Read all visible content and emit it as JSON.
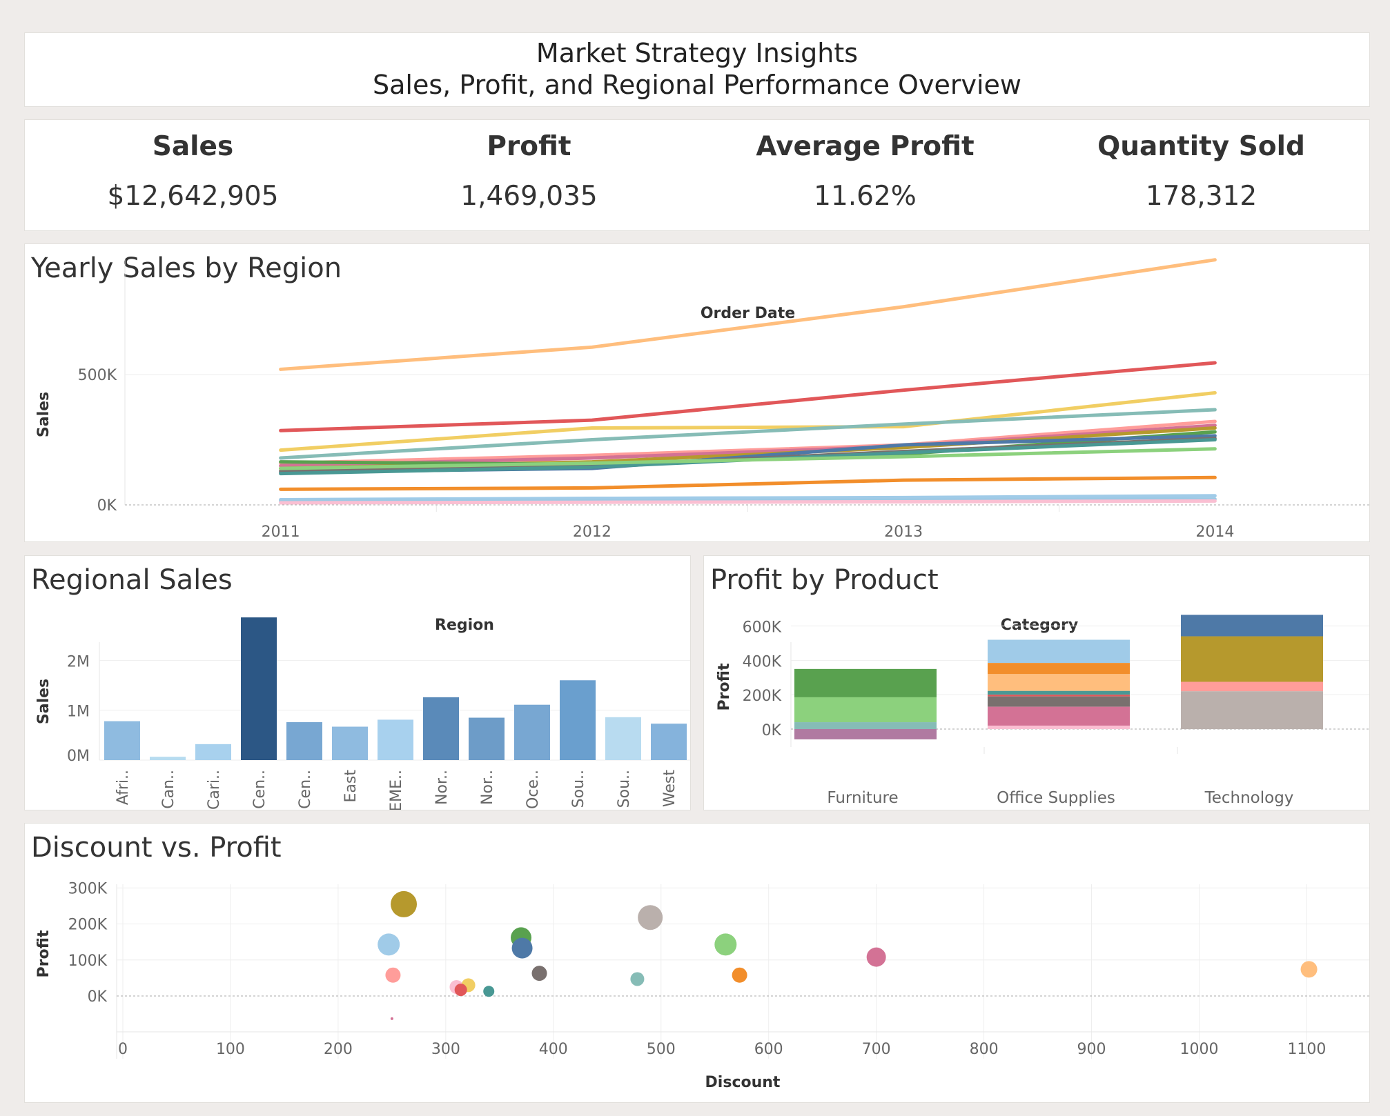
{
  "header": {
    "title_line1": "Market Strategy Insights",
    "title_line2": "Sales, Profit, and Regional Performance Overview"
  },
  "kpis": [
    {
      "label": "Sales",
      "value": "$12,642,905"
    },
    {
      "label": "Profit",
      "value": "1,469,035"
    },
    {
      "label": "Average Profit",
      "value": "11.62%"
    },
    {
      "label": "Quantity Sold",
      "value": "178,312"
    }
  ],
  "panels": {
    "line_title": "Yearly Sales by Region",
    "bar_title": "Regional Sales",
    "stack_title": "Profit by Product",
    "scatter_title": "Discount vs. Profit"
  },
  "chart_data": [
    {
      "type": "line",
      "title": "Yearly Sales by Region",
      "xlabel": "Order Date",
      "ylabel": "Sales",
      "x": [
        "2011",
        "2012",
        "2013",
        "2014"
      ],
      "ylim": [
        0,
        1000000
      ],
      "yticks": [
        {
          "v": 500000,
          "label": "500K"
        },
        {
          "v": 0,
          "label": "0K"
        }
      ],
      "series": [
        {
          "color": "#ffbe7d",
          "values": [
            520000,
            605000,
            760000,
            940000
          ]
        },
        {
          "color": "#e15759",
          "values": [
            285000,
            325000,
            440000,
            545000
          ]
        },
        {
          "color": "#f1ce63",
          "values": [
            210000,
            295000,
            300000,
            430000
          ]
        },
        {
          "color": "#86bcb6",
          "values": [
            180000,
            250000,
            310000,
            365000
          ]
        },
        {
          "color": "#ff9d9a",
          "values": [
            160000,
            190000,
            230000,
            320000
          ]
        },
        {
          "color": "#d37295",
          "values": [
            150000,
            180000,
            225000,
            305000
          ]
        },
        {
          "color": "#b6992d",
          "values": [
            140000,
            165000,
            220000,
            295000
          ]
        },
        {
          "color": "#59a14f",
          "values": [
            165000,
            155000,
            195000,
            280000
          ]
        },
        {
          "color": "#4e79a7",
          "values": [
            125000,
            140000,
            230000,
            265000
          ]
        },
        {
          "color": "#79706e",
          "values": [
            130000,
            150000,
            205000,
            255000
          ]
        },
        {
          "color": "#499894",
          "values": [
            120000,
            145000,
            200000,
            250000
          ]
        },
        {
          "color": "#8cd17d",
          "values": [
            140000,
            160000,
            185000,
            215000
          ]
        },
        {
          "color": "#f28e2b",
          "values": [
            60000,
            65000,
            95000,
            105000
          ]
        },
        {
          "color": "#a0cbe8",
          "values": [
            20000,
            25000,
            28000,
            35000
          ]
        },
        {
          "color": "#9dc9e4",
          "values": [
            15000,
            15000,
            18000,
            22000
          ]
        },
        {
          "color": "#fabfd2",
          "values": [
            8000,
            10000,
            12000,
            15000
          ]
        }
      ]
    },
    {
      "type": "bar",
      "title": "Regional Sales",
      "xlabel": "Region",
      "ylabel": "Sales",
      "categories": [
        "Afri..",
        "Can..",
        "Cari..",
        "Cen..",
        "Cen..",
        "East",
        "EME..",
        "Nor..",
        "Nor..",
        "Oce..",
        "Sou..",
        "Sou..",
        "West"
      ],
      "values": [
        780000,
        67000,
        320000,
        2860000,
        760000,
        670000,
        810000,
        1260000,
        850000,
        1110000,
        1600000,
        860000,
        730000
      ],
      "colors": [
        "#8fbbe0",
        "#b7dcf0",
        "#a8d1ee",
        "#2c5785",
        "#78a7d2",
        "#8fbbe0",
        "#a8d1ee",
        "#5a8ab9",
        "#6d9cc8",
        "#78a7d2",
        "#6a9fce",
        "#b8dbf0",
        "#85b3dc"
      ],
      "ylim": [
        0,
        3000000
      ],
      "yticks": [
        {
          "v": 2000000,
          "label": "2M"
        },
        {
          "v": 1000000,
          "label": "1M"
        },
        {
          "v": 0,
          "label": "0M"
        }
      ]
    },
    {
      "type": "bar",
      "stacked": true,
      "title": "Profit by Product",
      "xlabel": "Category",
      "ylabel": "Profit",
      "categories": [
        "Furniture",
        "Office Supplies",
        "Technology"
      ],
      "ylim": [
        -70000,
        700000
      ],
      "yticks": [
        {
          "v": 600000,
          "label": "600K"
        },
        {
          "v": 400000,
          "label": "400K"
        },
        {
          "v": 200000,
          "label": "200K"
        },
        {
          "v": 0,
          "label": "0K"
        }
      ],
      "segments": [
        [
          {
            "from": 185000,
            "to": 350000,
            "color": "#59a14f"
          },
          {
            "from": 40000,
            "to": 185000,
            "color": "#8cd17d"
          },
          {
            "from": 0,
            "to": 40000,
            "color": "#86bcb6"
          },
          {
            "from": -60000,
            "to": 0,
            "color": "#b07aa1"
          }
        ],
        [
          {
            "from": 385000,
            "to": 520000,
            "color": "#a0cbe8"
          },
          {
            "from": 320000,
            "to": 385000,
            "color": "#f28e2b"
          },
          {
            "from": 222000,
            "to": 320000,
            "color": "#ffbe7d"
          },
          {
            "from": 200000,
            "to": 222000,
            "color": "#499894"
          },
          {
            "from": 190000,
            "to": 200000,
            "color": "#e15759"
          },
          {
            "from": 130000,
            "to": 190000,
            "color": "#79706e"
          },
          {
            "from": 20000,
            "to": 130000,
            "color": "#d37295"
          },
          {
            "from": 0,
            "to": 20000,
            "color": "#fabfd2"
          }
        ],
        [
          {
            "from": 540000,
            "to": 665000,
            "color": "#4e79a7"
          },
          {
            "from": 275000,
            "to": 540000,
            "color": "#b6992d"
          },
          {
            "from": 220000,
            "to": 275000,
            "color": "#ff9d9a"
          },
          {
            "from": 0,
            "to": 220000,
            "color": "#bab0ac"
          }
        ]
      ]
    },
    {
      "type": "scatter",
      "title": "Discount vs. Profit",
      "xlabel": "Discount",
      "ylabel": "Profit",
      "xlim": [
        0,
        1160
      ],
      "ylim": [
        -75000,
        310000
      ],
      "xticks": [
        0,
        100,
        200,
        300,
        400,
        500,
        600,
        700,
        800,
        900,
        1000,
        1100
      ],
      "yticks": [
        {
          "v": 300000,
          "label": "300K"
        },
        {
          "v": 200000,
          "label": "200K"
        },
        {
          "v": 100000,
          "label": "100K"
        },
        {
          "v": 0,
          "label": "0K"
        }
      ],
      "points": [
        {
          "x": 261,
          "y": 255000,
          "r": 19,
          "color": "#b6992d"
        },
        {
          "x": 490,
          "y": 218000,
          "r": 18,
          "color": "#bab0ac"
        },
        {
          "x": 370,
          "y": 162000,
          "r": 15,
          "color": "#59a14f"
        },
        {
          "x": 247,
          "y": 143000,
          "r": 16,
          "color": "#a0cbe8"
        },
        {
          "x": 371,
          "y": 133000,
          "r": 15,
          "color": "#4e79a7"
        },
        {
          "x": 560,
          "y": 143000,
          "r": 16,
          "color": "#8cd17d"
        },
        {
          "x": 700,
          "y": 108000,
          "r": 14,
          "color": "#d37295"
        },
        {
          "x": 1102,
          "y": 74000,
          "r": 12,
          "color": "#ffbe7d"
        },
        {
          "x": 251,
          "y": 58000,
          "r": 11,
          "color": "#ff9d9a"
        },
        {
          "x": 387,
          "y": 63000,
          "r": 11,
          "color": "#79706e"
        },
        {
          "x": 573,
          "y": 58000,
          "r": 11,
          "color": "#f28e2b"
        },
        {
          "x": 478,
          "y": 47000,
          "r": 10,
          "color": "#86bcb6"
        },
        {
          "x": 310,
          "y": 25000,
          "r": 10,
          "color": "#fabfd2"
        },
        {
          "x": 321,
          "y": 30000,
          "r": 10,
          "color": "#f1ce63"
        },
        {
          "x": 314,
          "y": 17000,
          "r": 9,
          "color": "#e15759"
        },
        {
          "x": 340,
          "y": 13000,
          "r": 8,
          "color": "#499894"
        },
        {
          "x": 250,
          "y": -63000,
          "r": 2,
          "color": "#d37295"
        }
      ]
    }
  ]
}
